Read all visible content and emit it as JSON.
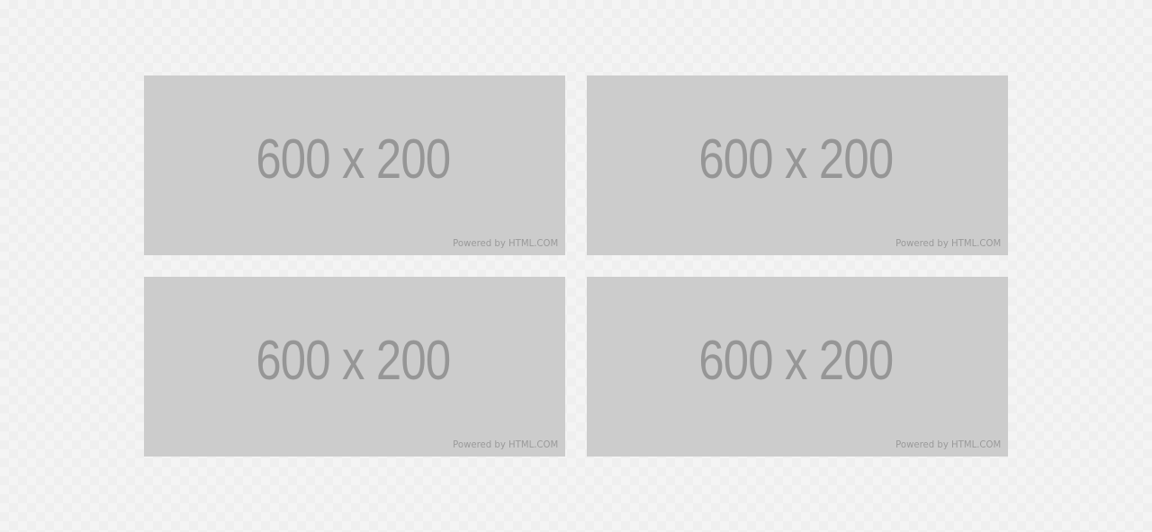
{
  "placeholders": [
    {
      "dimensions": "600 x 200",
      "watermark": "Powered by HTML.COM"
    },
    {
      "dimensions": "600 x 200",
      "watermark": "Powered by HTML.COM"
    },
    {
      "dimensions": "600 x 200",
      "watermark": "Powered by HTML.COM"
    },
    {
      "dimensions": "600 x 200",
      "watermark": "Powered by HTML.COM"
    }
  ],
  "colors": {
    "placeholder_background": "#cccccc",
    "placeholder_text": "#969696",
    "watermark_text": "#9a9a9a",
    "page_background": "#f4f4f4"
  }
}
